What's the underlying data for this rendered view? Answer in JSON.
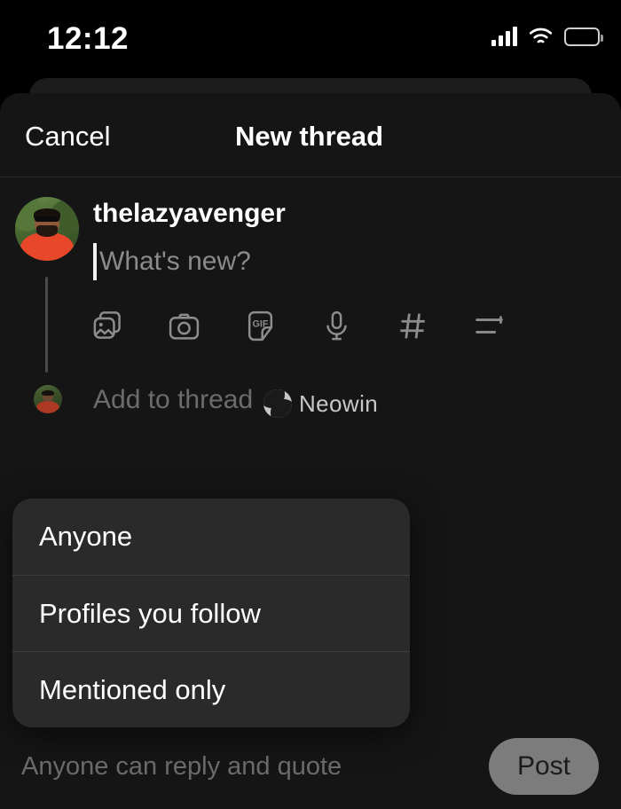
{
  "status_bar": {
    "time": "12:12",
    "cellular_icon": "signal-bars-icon",
    "wifi_icon": "wifi-icon",
    "battery_icon": "battery-icon",
    "battery_color": "#f5dd2c"
  },
  "nav": {
    "cancel_label": "Cancel",
    "title": "New thread"
  },
  "composer": {
    "username": "thelazyavenger",
    "placeholder": "What's new?",
    "add_to_thread_label": "Add to thread",
    "toolbar": [
      {
        "name": "photo-library-icon",
        "label": "Photo library"
      },
      {
        "name": "camera-icon",
        "label": "Camera"
      },
      {
        "name": "gif-icon",
        "label": "GIF",
        "text": "GIF"
      },
      {
        "name": "microphone-icon",
        "label": "Voice"
      },
      {
        "name": "hashtag-icon",
        "label": "Tag"
      },
      {
        "name": "poll-icon",
        "label": "Poll"
      }
    ]
  },
  "watermark": {
    "text": "Neowin",
    "mark_icon": "neowin-logo-icon"
  },
  "audience_menu": {
    "options": [
      {
        "label": "Anyone"
      },
      {
        "label": "Profiles you follow"
      },
      {
        "label": "Mentioned only"
      }
    ]
  },
  "bottom_bar": {
    "reply_note": "Anyone can reply and quote",
    "post_label": "Post"
  }
}
